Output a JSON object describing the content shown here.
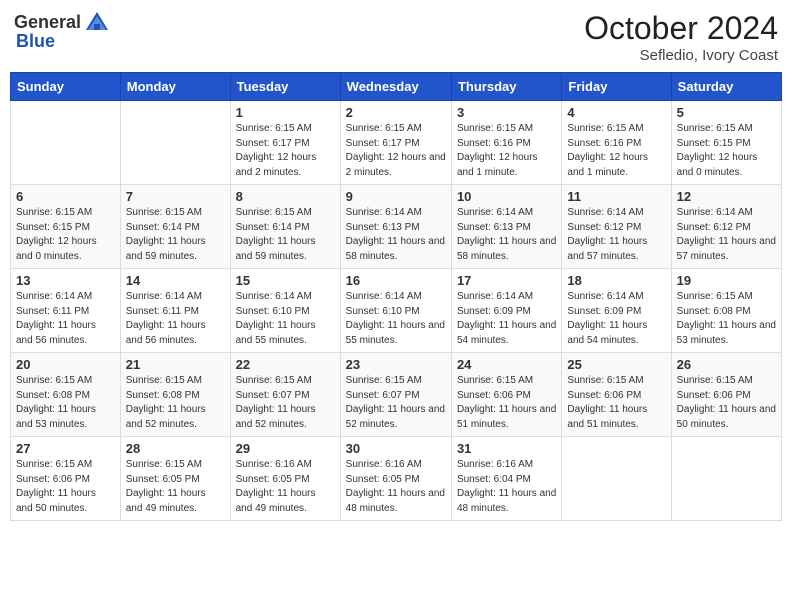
{
  "header": {
    "logo_general": "General",
    "logo_blue": "Blue",
    "month_title": "October 2024",
    "location": "Sefledio, Ivory Coast"
  },
  "weekdays": [
    "Sunday",
    "Monday",
    "Tuesday",
    "Wednesday",
    "Thursday",
    "Friday",
    "Saturday"
  ],
  "weeks": [
    [
      {
        "day": "",
        "sunrise": "",
        "sunset": "",
        "daylight": ""
      },
      {
        "day": "",
        "sunrise": "",
        "sunset": "",
        "daylight": ""
      },
      {
        "day": "1",
        "sunrise": "Sunrise: 6:15 AM",
        "sunset": "Sunset: 6:17 PM",
        "daylight": "Daylight: 12 hours and 2 minutes."
      },
      {
        "day": "2",
        "sunrise": "Sunrise: 6:15 AM",
        "sunset": "Sunset: 6:17 PM",
        "daylight": "Daylight: 12 hours and 2 minutes."
      },
      {
        "day": "3",
        "sunrise": "Sunrise: 6:15 AM",
        "sunset": "Sunset: 6:16 PM",
        "daylight": "Daylight: 12 hours and 1 minute."
      },
      {
        "day": "4",
        "sunrise": "Sunrise: 6:15 AM",
        "sunset": "Sunset: 6:16 PM",
        "daylight": "Daylight: 12 hours and 1 minute."
      },
      {
        "day": "5",
        "sunrise": "Sunrise: 6:15 AM",
        "sunset": "Sunset: 6:15 PM",
        "daylight": "Daylight: 12 hours and 0 minutes."
      }
    ],
    [
      {
        "day": "6",
        "sunrise": "Sunrise: 6:15 AM",
        "sunset": "Sunset: 6:15 PM",
        "daylight": "Daylight: 12 hours and 0 minutes."
      },
      {
        "day": "7",
        "sunrise": "Sunrise: 6:15 AM",
        "sunset": "Sunset: 6:14 PM",
        "daylight": "Daylight: 11 hours and 59 minutes."
      },
      {
        "day": "8",
        "sunrise": "Sunrise: 6:15 AM",
        "sunset": "Sunset: 6:14 PM",
        "daylight": "Daylight: 11 hours and 59 minutes."
      },
      {
        "day": "9",
        "sunrise": "Sunrise: 6:14 AM",
        "sunset": "Sunset: 6:13 PM",
        "daylight": "Daylight: 11 hours and 58 minutes."
      },
      {
        "day": "10",
        "sunrise": "Sunrise: 6:14 AM",
        "sunset": "Sunset: 6:13 PM",
        "daylight": "Daylight: 11 hours and 58 minutes."
      },
      {
        "day": "11",
        "sunrise": "Sunrise: 6:14 AM",
        "sunset": "Sunset: 6:12 PM",
        "daylight": "Daylight: 11 hours and 57 minutes."
      },
      {
        "day": "12",
        "sunrise": "Sunrise: 6:14 AM",
        "sunset": "Sunset: 6:12 PM",
        "daylight": "Daylight: 11 hours and 57 minutes."
      }
    ],
    [
      {
        "day": "13",
        "sunrise": "Sunrise: 6:14 AM",
        "sunset": "Sunset: 6:11 PM",
        "daylight": "Daylight: 11 hours and 56 minutes."
      },
      {
        "day": "14",
        "sunrise": "Sunrise: 6:14 AM",
        "sunset": "Sunset: 6:11 PM",
        "daylight": "Daylight: 11 hours and 56 minutes."
      },
      {
        "day": "15",
        "sunrise": "Sunrise: 6:14 AM",
        "sunset": "Sunset: 6:10 PM",
        "daylight": "Daylight: 11 hours and 55 minutes."
      },
      {
        "day": "16",
        "sunrise": "Sunrise: 6:14 AM",
        "sunset": "Sunset: 6:10 PM",
        "daylight": "Daylight: 11 hours and 55 minutes."
      },
      {
        "day": "17",
        "sunrise": "Sunrise: 6:14 AM",
        "sunset": "Sunset: 6:09 PM",
        "daylight": "Daylight: 11 hours and 54 minutes."
      },
      {
        "day": "18",
        "sunrise": "Sunrise: 6:14 AM",
        "sunset": "Sunset: 6:09 PM",
        "daylight": "Daylight: 11 hours and 54 minutes."
      },
      {
        "day": "19",
        "sunrise": "Sunrise: 6:15 AM",
        "sunset": "Sunset: 6:08 PM",
        "daylight": "Daylight: 11 hours and 53 minutes."
      }
    ],
    [
      {
        "day": "20",
        "sunrise": "Sunrise: 6:15 AM",
        "sunset": "Sunset: 6:08 PM",
        "daylight": "Daylight: 11 hours and 53 minutes."
      },
      {
        "day": "21",
        "sunrise": "Sunrise: 6:15 AM",
        "sunset": "Sunset: 6:08 PM",
        "daylight": "Daylight: 11 hours and 52 minutes."
      },
      {
        "day": "22",
        "sunrise": "Sunrise: 6:15 AM",
        "sunset": "Sunset: 6:07 PM",
        "daylight": "Daylight: 11 hours and 52 minutes."
      },
      {
        "day": "23",
        "sunrise": "Sunrise: 6:15 AM",
        "sunset": "Sunset: 6:07 PM",
        "daylight": "Daylight: 11 hours and 52 minutes."
      },
      {
        "day": "24",
        "sunrise": "Sunrise: 6:15 AM",
        "sunset": "Sunset: 6:06 PM",
        "daylight": "Daylight: 11 hours and 51 minutes."
      },
      {
        "day": "25",
        "sunrise": "Sunrise: 6:15 AM",
        "sunset": "Sunset: 6:06 PM",
        "daylight": "Daylight: 11 hours and 51 minutes."
      },
      {
        "day": "26",
        "sunrise": "Sunrise: 6:15 AM",
        "sunset": "Sunset: 6:06 PM",
        "daylight": "Daylight: 11 hours and 50 minutes."
      }
    ],
    [
      {
        "day": "27",
        "sunrise": "Sunrise: 6:15 AM",
        "sunset": "Sunset: 6:06 PM",
        "daylight": "Daylight: 11 hours and 50 minutes."
      },
      {
        "day": "28",
        "sunrise": "Sunrise: 6:15 AM",
        "sunset": "Sunset: 6:05 PM",
        "daylight": "Daylight: 11 hours and 49 minutes."
      },
      {
        "day": "29",
        "sunrise": "Sunrise: 6:16 AM",
        "sunset": "Sunset: 6:05 PM",
        "daylight": "Daylight: 11 hours and 49 minutes."
      },
      {
        "day": "30",
        "sunrise": "Sunrise: 6:16 AM",
        "sunset": "Sunset: 6:05 PM",
        "daylight": "Daylight: 11 hours and 48 minutes."
      },
      {
        "day": "31",
        "sunrise": "Sunrise: 6:16 AM",
        "sunset": "Sunset: 6:04 PM",
        "daylight": "Daylight: 11 hours and 48 minutes."
      },
      {
        "day": "",
        "sunrise": "",
        "sunset": "",
        "daylight": ""
      },
      {
        "day": "",
        "sunrise": "",
        "sunset": "",
        "daylight": ""
      }
    ]
  ]
}
